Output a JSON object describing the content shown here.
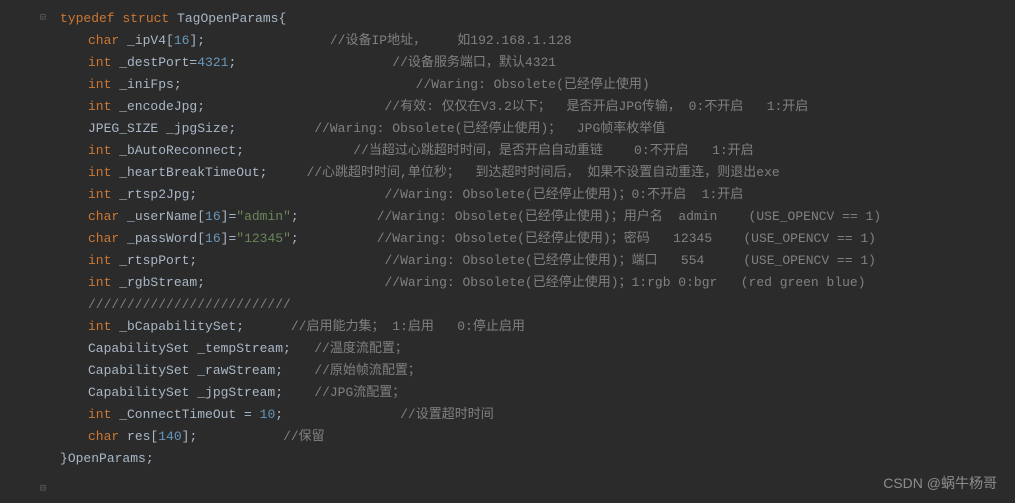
{
  "fold_top_glyph": "⊟",
  "fold_bot_glyph": "⊟",
  "code_lines": [
    {
      "segments": [
        {
          "t": "typedef",
          "c": "kw"
        },
        {
          "t": " ",
          "c": "punc"
        },
        {
          "t": "struct",
          "c": "kw"
        },
        {
          "t": " ",
          "c": "punc"
        },
        {
          "t": "TagOpenParams",
          "c": "ident"
        },
        {
          "t": "{",
          "c": "punc"
        }
      ],
      "indent": 0
    },
    {
      "segments": [
        {
          "t": "char",
          "c": "type"
        },
        {
          "t": " _ipV4[",
          "c": "ident"
        },
        {
          "t": "16",
          "c": "num"
        },
        {
          "t": "];",
          "c": "punc"
        },
        {
          "t": "                ",
          "c": "punc"
        },
        {
          "t": "//设备IP地址，    如192.168.1.128",
          "c": "cmt"
        }
      ],
      "indent": 1
    },
    {
      "segments": [
        {
          "t": "int",
          "c": "type"
        },
        {
          "t": " _destPort=",
          "c": "ident"
        },
        {
          "t": "4321",
          "c": "num"
        },
        {
          "t": ";",
          "c": "punc"
        },
        {
          "t": "                    ",
          "c": "punc"
        },
        {
          "t": "//设备服务端口，默认4321",
          "c": "cmt"
        }
      ],
      "indent": 1
    },
    {
      "segments": [
        {
          "t": "int",
          "c": "type"
        },
        {
          "t": " _iniFps;",
          "c": "ident"
        },
        {
          "t": "                              ",
          "c": "punc"
        },
        {
          "t": "//Waring: Obsolete(已经停止使用)",
          "c": "cmt"
        }
      ],
      "indent": 1
    },
    {
      "segments": [
        {
          "t": "int",
          "c": "type"
        },
        {
          "t": " _encodeJpg;",
          "c": "ident"
        },
        {
          "t": "                       ",
          "c": "punc"
        },
        {
          "t": "//有效: 仅仅在V3.2以下；  是否开启JPG传输， 0:不开启   1:开启",
          "c": "cmt"
        }
      ],
      "indent": 1
    },
    {
      "segments": [
        {
          "t": "JPEG_SIZE",
          "c": "ident"
        },
        {
          "t": " _jpgSize;",
          "c": "ident"
        },
        {
          "t": "          ",
          "c": "punc"
        },
        {
          "t": "//Waring: Obsolete(已经停止使用)；  JPG帧率枚举值",
          "c": "cmt"
        }
      ],
      "indent": 1
    },
    {
      "segments": [
        {
          "t": "int",
          "c": "type"
        },
        {
          "t": " _bAutoReconnect;",
          "c": "ident"
        },
        {
          "t": "              ",
          "c": "punc"
        },
        {
          "t": "//当超过心跳超时时间，是否开启自动重链    0:不开启   1:开启",
          "c": "cmt"
        }
      ],
      "indent": 1
    },
    {
      "segments": [
        {
          "t": "int",
          "c": "type"
        },
        {
          "t": " _heartBreakTimeOut;",
          "c": "ident"
        },
        {
          "t": "     ",
          "c": "punc"
        },
        {
          "t": "//心跳超时时间,单位秒；  到达超时时间后， 如果不设置自动重连，则退出exe",
          "c": "cmt"
        }
      ],
      "indent": 1
    },
    {
      "segments": [
        {
          "t": "int",
          "c": "type"
        },
        {
          "t": " _rtsp2Jpg;",
          "c": "ident"
        },
        {
          "t": "                        ",
          "c": "punc"
        },
        {
          "t": "//Waring: Obsolete(已经停止使用)；0:不开启  1:开启",
          "c": "cmt"
        }
      ],
      "indent": 1
    },
    {
      "segments": [
        {
          "t": "char",
          "c": "type"
        },
        {
          "t": " _userName[",
          "c": "ident"
        },
        {
          "t": "16",
          "c": "num"
        },
        {
          "t": "]=",
          "c": "punc"
        },
        {
          "t": "\"admin\"",
          "c": "str"
        },
        {
          "t": ";",
          "c": "punc"
        },
        {
          "t": "          ",
          "c": "punc"
        },
        {
          "t": "//Waring: Obsolete(已经停止使用)；用户名  admin    (USE_OPENCV == 1)",
          "c": "cmt"
        }
      ],
      "indent": 1
    },
    {
      "segments": [
        {
          "t": "char",
          "c": "type"
        },
        {
          "t": " _passWord[",
          "c": "ident"
        },
        {
          "t": "16",
          "c": "num"
        },
        {
          "t": "]=",
          "c": "punc"
        },
        {
          "t": "\"12345\"",
          "c": "str"
        },
        {
          "t": ";",
          "c": "punc"
        },
        {
          "t": "          ",
          "c": "punc"
        },
        {
          "t": "//Waring: Obsolete(已经停止使用)；密码   12345    (USE_OPENCV == 1)",
          "c": "cmt"
        }
      ],
      "indent": 1
    },
    {
      "segments": [
        {
          "t": "int",
          "c": "type"
        },
        {
          "t": " _rtspPort;",
          "c": "ident"
        },
        {
          "t": "                        ",
          "c": "punc"
        },
        {
          "t": "//Waring: Obsolete(已经停止使用)；端口   554     (USE_OPENCV == 1)",
          "c": "cmt"
        }
      ],
      "indent": 1
    },
    {
      "segments": [
        {
          "t": "int",
          "c": "type"
        },
        {
          "t": " _rgbStream;",
          "c": "ident"
        },
        {
          "t": "                       ",
          "c": "punc"
        },
        {
          "t": "//Waring: Obsolete(已经停止使用)；1:rgb 0:bgr   (red green blue)",
          "c": "cmt"
        }
      ],
      "indent": 1
    },
    {
      "segments": [
        {
          "t": "//////////////////////////",
          "c": "cmt"
        }
      ],
      "indent": 1
    },
    {
      "segments": [
        {
          "t": "int",
          "c": "type"
        },
        {
          "t": " _bCapabilitySet;",
          "c": "ident"
        },
        {
          "t": "      ",
          "c": "punc"
        },
        {
          "t": "//启用能力集； 1:启用   0:停止启用",
          "c": "cmt"
        }
      ],
      "indent": 1
    },
    {
      "segments": [
        {
          "t": "CapabilitySet",
          "c": "ident"
        },
        {
          "t": " _tempStream;",
          "c": "ident"
        },
        {
          "t": "   ",
          "c": "punc"
        },
        {
          "t": "//温度流配置；",
          "c": "cmt"
        }
      ],
      "indent": 1
    },
    {
      "segments": [
        {
          "t": "CapabilitySet",
          "c": "ident"
        },
        {
          "t": " _rawStream;",
          "c": "ident"
        },
        {
          "t": "    ",
          "c": "punc"
        },
        {
          "t": "//原始帧流配置；",
          "c": "cmt"
        }
      ],
      "indent": 1
    },
    {
      "segments": [
        {
          "t": "CapabilitySet",
          "c": "ident"
        },
        {
          "t": " _jpgStream;",
          "c": "ident"
        },
        {
          "t": "    ",
          "c": "punc"
        },
        {
          "t": "//JPG流配置；",
          "c": "cmt"
        }
      ],
      "indent": 1
    },
    {
      "segments": [
        {
          "t": "int",
          "c": "type"
        },
        {
          "t": " _ConnectTimeOut = ",
          "c": "ident"
        },
        {
          "t": "10",
          "c": "num"
        },
        {
          "t": ";",
          "c": "punc"
        },
        {
          "t": "               ",
          "c": "punc"
        },
        {
          "t": "//设置超时时间",
          "c": "cmt"
        }
      ],
      "indent": 1
    },
    {
      "segments": [
        {
          "t": "char",
          "c": "type"
        },
        {
          "t": " res[",
          "c": "ident"
        },
        {
          "t": "140",
          "c": "num"
        },
        {
          "t": "];",
          "c": "punc"
        },
        {
          "t": "           ",
          "c": "punc"
        },
        {
          "t": "//保留",
          "c": "cmt"
        }
      ],
      "indent": 1
    },
    {
      "segments": [
        {
          "t": "}",
          "c": "punc"
        },
        {
          "t": "OpenParams",
          "c": "ident"
        },
        {
          "t": ";",
          "c": "punc"
        }
      ],
      "indent": 0
    }
  ],
  "watermark": "CSDN @蜗牛杨哥"
}
